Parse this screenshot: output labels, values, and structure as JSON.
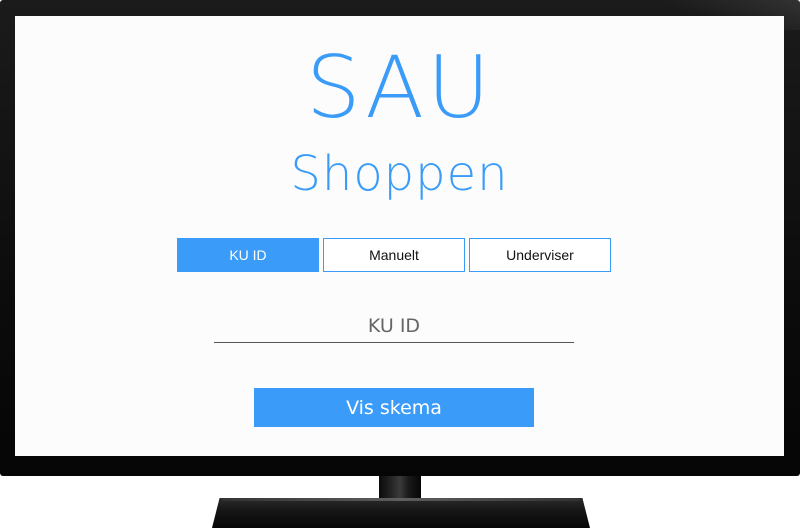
{
  "brand": {
    "line1": "SAU",
    "line2": "Shoppen",
    "color": "#3a9cf8"
  },
  "tabs": [
    {
      "label": "KU ID",
      "active": true
    },
    {
      "label": "Manuelt",
      "active": false
    },
    {
      "label": "Underviser",
      "active": false
    }
  ],
  "input": {
    "placeholder": "KU ID",
    "value": ""
  },
  "submit": {
    "label": "Vis skema"
  }
}
